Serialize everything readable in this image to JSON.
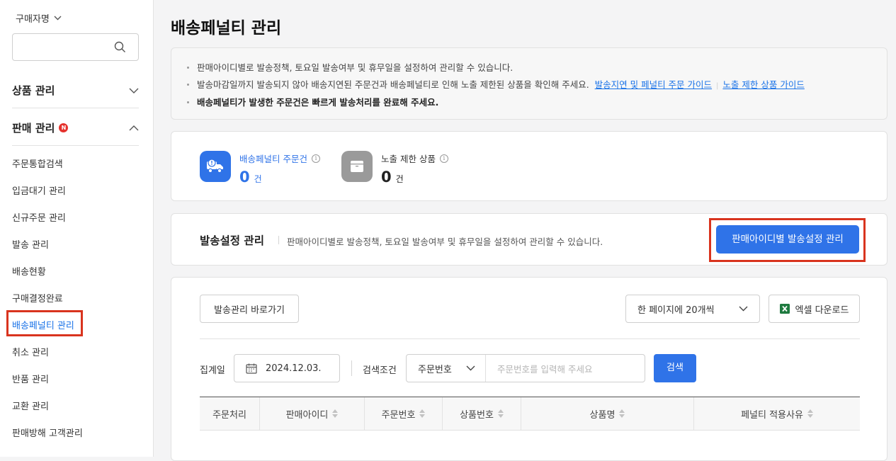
{
  "sidebar": {
    "buyer_label": "구매자명",
    "search_placeholder": "",
    "sections": [
      {
        "label": "상품 관리"
      },
      {
        "label": "판매 관리",
        "badge": "N"
      }
    ],
    "items": [
      {
        "label": "주문통합검색"
      },
      {
        "label": "입금대기 관리"
      },
      {
        "label": "신규주문 관리"
      },
      {
        "label": "발송 관리"
      },
      {
        "label": "배송현황"
      },
      {
        "label": "구매결정완료"
      },
      {
        "label": "배송페널티 관리",
        "active": true
      },
      {
        "label": "취소 관리"
      },
      {
        "label": "반품 관리"
      },
      {
        "label": "교환 관리"
      },
      {
        "label": "판매방해 고객관리"
      }
    ]
  },
  "page": {
    "title": "배송페널티 관리"
  },
  "notice": {
    "line1": "판매아이디별로 발송정책, 토요일 발송여부 및 휴무일을 설정하여 관리할 수 있습니다.",
    "line2": "발송마감일까지 발송되지 않아 배송지연된 주문건과 배송페널티로 인해 노출 제한된 상품을 확인해 주세요.",
    "link1": "발송지연 및 페널티 주문 가이드",
    "link2": "노출 제한 상품 가이드",
    "line3": "배송페널티가 발생한 주문건은 빠르게 발송처리를 완료해 주세요."
  },
  "stats": [
    {
      "label": "배송페널티 주문건",
      "count": "0",
      "unit": "건",
      "color": "#2f73e8"
    },
    {
      "label": "노출 제한 상품",
      "count": "0",
      "unit": "건",
      "color": "#9a9a9a"
    }
  ],
  "ship_settings": {
    "title": "발송설정 관리",
    "desc": "판매아이디별로 발송정책, 토요일 발송여부 및 휴무일을 설정하여 관리할 수 있습니다.",
    "button": "판매아이디별 발송설정 관리"
  },
  "toolbar": {
    "shortcut_button": "발송관리 바로가기",
    "page_size": "한 페이지에 20개씩",
    "excel_button": "엑셀 다운로드"
  },
  "filters": {
    "date_label": "집계일",
    "date_value": "2024.12.03.",
    "cond_label": "검색조건",
    "cond_value": "주문번호",
    "keyword_placeholder": "주문번호를 입력해 주세요",
    "search_button": "검색"
  },
  "table": {
    "columns": [
      "주문처리",
      "판매아이디",
      "주문번호",
      "상품번호",
      "상품명",
      "페널티 적용사유"
    ]
  },
  "colors": {
    "accent": "#2f73e8",
    "highlight": "#d9341e",
    "badge": "#e5322d"
  }
}
